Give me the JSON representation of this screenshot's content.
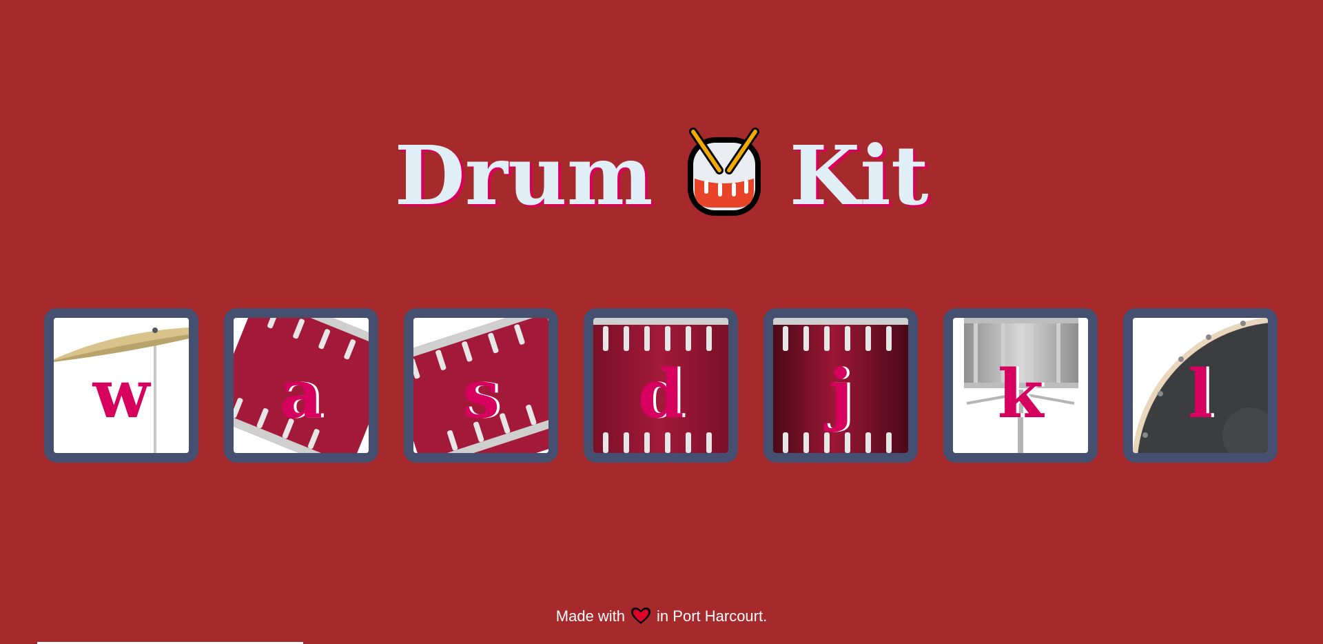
{
  "title": {
    "word1": "Drum",
    "emoji_icon": "drum-with-drumsticks-icon",
    "word2": "Kit"
  },
  "pads": [
    {
      "key": "w",
      "instrument_icon": "crash-cymbal-icon"
    },
    {
      "key": "a",
      "instrument_icon": "tom-drum-tilted-icon"
    },
    {
      "key": "s",
      "instrument_icon": "tom-drum-tilted-icon"
    },
    {
      "key": "d",
      "instrument_icon": "floor-tom-icon"
    },
    {
      "key": "j",
      "instrument_icon": "floor-tom-dark-icon"
    },
    {
      "key": "k",
      "instrument_icon": "snare-drum-icon"
    },
    {
      "key": "l",
      "instrument_icon": "kick-drum-icon"
    }
  ],
  "footer": {
    "prefix": "Made with",
    "heart_icon": "heart-icon",
    "suffix": "in Port Harcourt."
  },
  "colors": {
    "background": "#a6292b",
    "title_text": "#e0eef5",
    "accent": "#d6005e",
    "pad_border": "#454f6f",
    "drum_shell": "#a3193a",
    "heart": "#e0002a"
  }
}
